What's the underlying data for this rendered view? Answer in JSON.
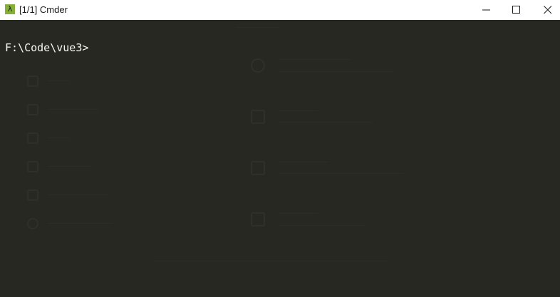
{
  "window": {
    "title": "[1/1] Cmder",
    "app_icon_glyph": "λ",
    "controls": [
      "minimize-icon",
      "maximize-icon",
      "close-icon"
    ]
  },
  "console": {
    "prompt": "F:\\Code\\vue3>"
  },
  "colors": {
    "console_bg": "#272822",
    "prompt_text": "#f8f8f2",
    "titlebar_bg": "#ffffff",
    "app_icon_bg": "#84b038"
  }
}
